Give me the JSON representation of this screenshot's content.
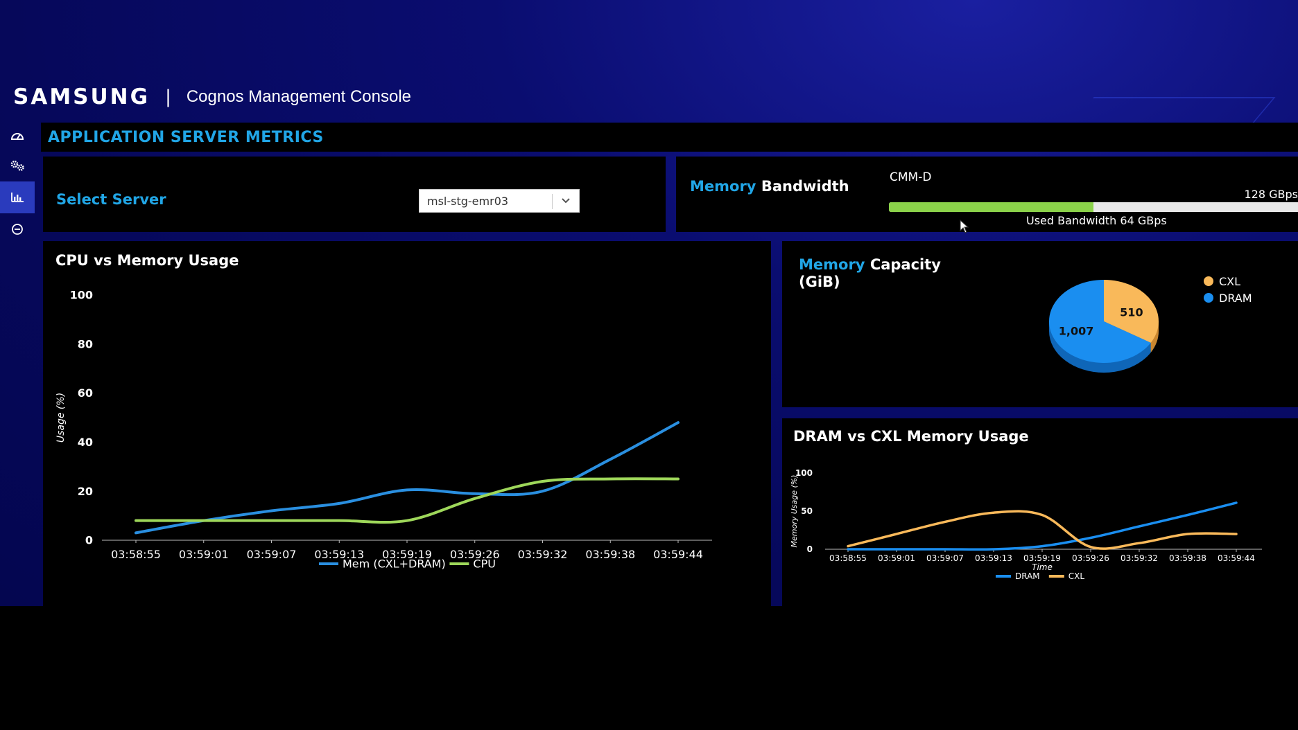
{
  "header": {
    "logo_text": "SAMSUNG",
    "separator": "|",
    "console_title": "Cognos Management Console"
  },
  "sidebar": {
    "items": [
      {
        "icon": "gauge-icon",
        "active": false
      },
      {
        "icon": "gears-icon",
        "active": false
      },
      {
        "icon": "bar-chart-icon",
        "active": true
      },
      {
        "icon": "minus-circle-icon",
        "active": false
      }
    ]
  },
  "page_title": "APPLICATION SERVER METRICS",
  "server_select": {
    "label": "Select Server",
    "selected": "msl-stg-emr03"
  },
  "bandwidth": {
    "title_highlight": "Memory",
    "title_rest": "Bandwidth",
    "device": "CMM-D",
    "max_label": "128 GBps",
    "used_label": "Used Bandwidth 64 GBps",
    "used_fraction": 0.5
  },
  "colors": {
    "accent": "#21a6e6",
    "mem_line": "#2a8fe0",
    "cpu_line": "#9ed75a",
    "cxl": "#f9b95a",
    "dram": "#1a8ef0",
    "bandwidth_fill": "#8bd24a"
  },
  "chart_data": [
    {
      "type": "line",
      "title": "CPU vs Memory Usage",
      "ylabel": "Usage (%)",
      "xlabel": "",
      "x": [
        "03:58:55",
        "03:59:01",
        "03:59:07",
        "03:59:13",
        "03:59:19",
        "03:59:26",
        "03:59:32",
        "03:59:38",
        "03:59:44"
      ],
      "ylim": [
        0,
        100
      ],
      "yticks": [
        "0",
        "20",
        "40",
        "60",
        "80",
        "100"
      ],
      "series": [
        {
          "name": "Mem (CXL+DRAM)",
          "values": [
            3,
            8,
            12,
            15,
            20.5,
            19,
            20,
            33,
            48
          ]
        },
        {
          "name": "CPU",
          "values": [
            8,
            8,
            8,
            8,
            8,
            17,
            24,
            25,
            25
          ]
        }
      ],
      "legend": "bottom-center",
      "grid": false
    },
    {
      "type": "pie",
      "title_highlight": "Memory",
      "title_rest": "Capacity",
      "title_unit": "(GiB)",
      "slices": [
        {
          "name": "CXL",
          "value": 510,
          "label": "510"
        },
        {
          "name": "DRAM",
          "value": 1007,
          "label": "1,007"
        }
      ],
      "legend": "top-right"
    },
    {
      "type": "line",
      "title": "DRAM vs CXL Memory Usage",
      "ylabel": "Memory Usage (%)",
      "xlabel": "Time",
      "x": [
        "03:58:55",
        "03:59:01",
        "03:59:07",
        "03:59:13",
        "03:59:19",
        "03:59:26",
        "03:59:32",
        "03:59:38",
        "03:59:44"
      ],
      "ylim": [
        0,
        100
      ],
      "yticks": [
        "0",
        "50",
        "100"
      ],
      "series": [
        {
          "name": "DRAM",
          "values": [
            0,
            0,
            0,
            0,
            4,
            15,
            30,
            45,
            61
          ]
        },
        {
          "name": "CXL",
          "values": [
            4,
            20,
            36,
            48,
            45,
            3,
            8,
            20,
            20
          ]
        }
      ],
      "legend": "bottom-center",
      "grid": false
    }
  ]
}
